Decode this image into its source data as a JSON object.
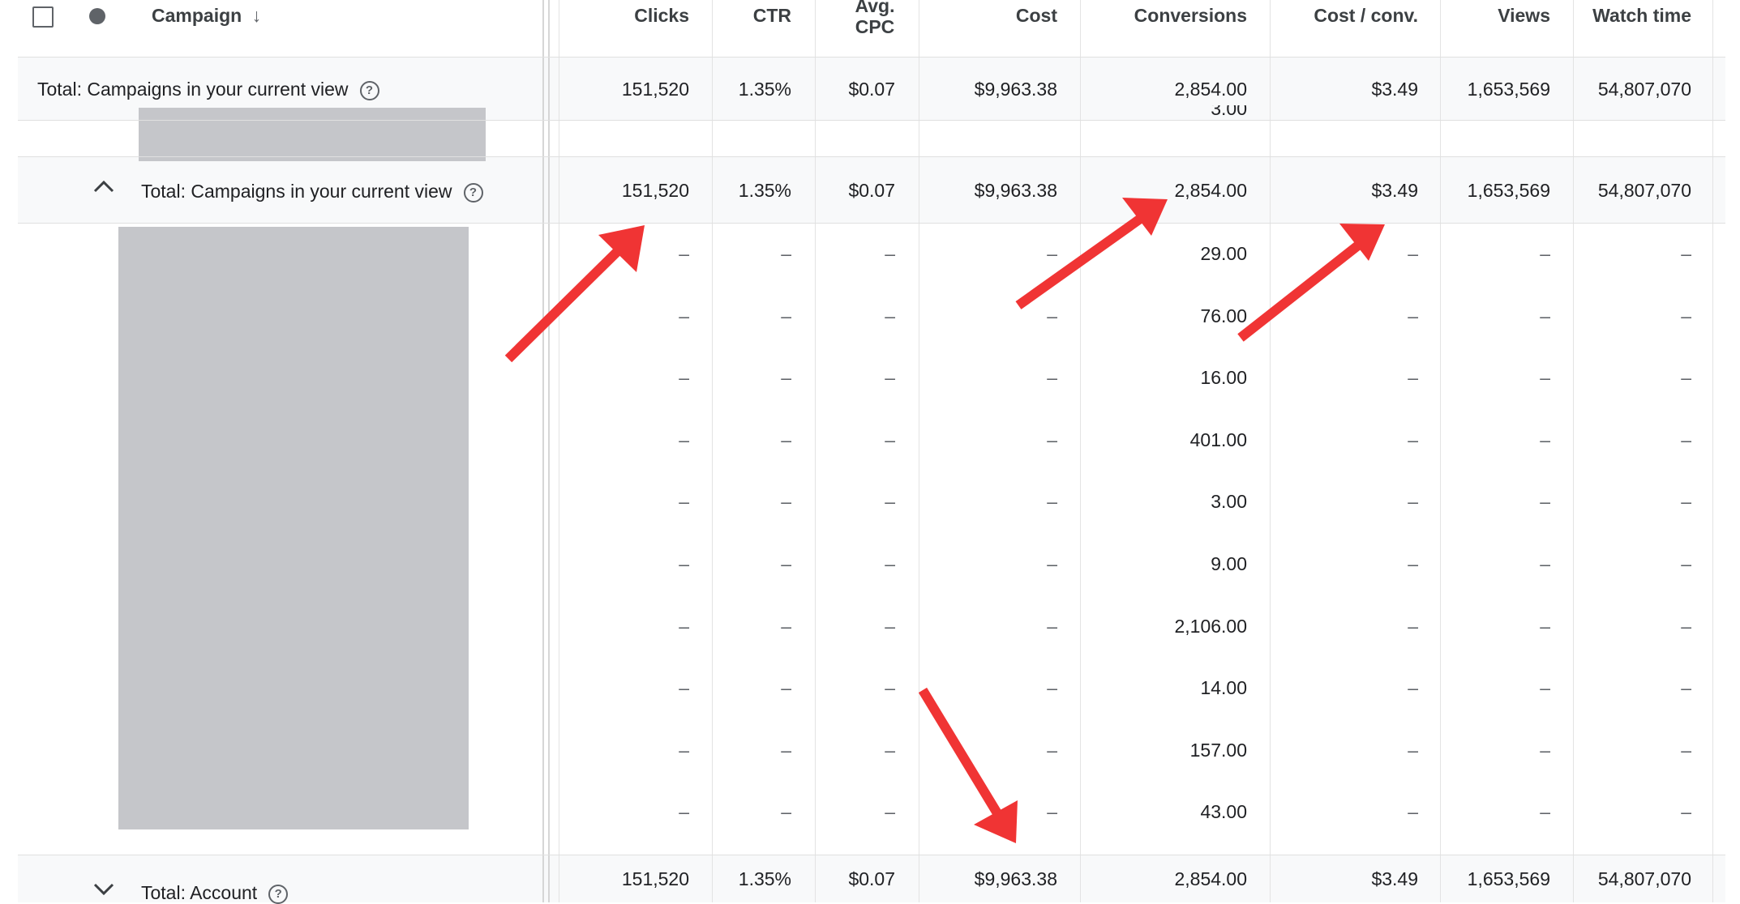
{
  "header": {
    "campaign_label": "Campaign",
    "columns": [
      {
        "key": "clicks",
        "label": "Clicks"
      },
      {
        "key": "ctr",
        "label": "CTR"
      },
      {
        "key": "avg_cpc",
        "label": "Avg.\nCPC"
      },
      {
        "key": "cost",
        "label": "Cost"
      },
      {
        "key": "conversions",
        "label": "Conversions"
      },
      {
        "key": "cost_conv",
        "label": "Cost / conv."
      },
      {
        "key": "views",
        "label": "Views"
      },
      {
        "key": "watch_time",
        "label": "Watch time"
      }
    ]
  },
  "total_view": {
    "label": "Total: Campaigns in your current view",
    "values": [
      "151,520",
      "1.35%",
      "$0.07",
      "$9,963.38",
      "2,854.00",
      "$3.49",
      "1,653,569",
      "54,807,070"
    ]
  },
  "partial_row_value": "3.00",
  "group_total": {
    "label": "Total: Campaigns in your current view",
    "values": [
      "151,520",
      "1.35%",
      "$0.07",
      "$9,963.38",
      "2,854.00",
      "$3.49",
      "1,653,569",
      "54,807,070"
    ]
  },
  "campaign_rows": [
    {
      "values": [
        "–",
        "–",
        "–",
        "–",
        "29.00",
        "–",
        "–",
        "–"
      ]
    },
    {
      "values": [
        "–",
        "–",
        "–",
        "–",
        "76.00",
        "–",
        "–",
        "–"
      ]
    },
    {
      "values": [
        "–",
        "–",
        "–",
        "–",
        "16.00",
        "–",
        "–",
        "–"
      ]
    },
    {
      "values": [
        "–",
        "–",
        "–",
        "–",
        "401.00",
        "–",
        "–",
        "–"
      ]
    },
    {
      "values": [
        "–",
        "–",
        "–",
        "–",
        "3.00",
        "–",
        "–",
        "–"
      ]
    },
    {
      "values": [
        "–",
        "–",
        "–",
        "–",
        "9.00",
        "–",
        "–",
        "–"
      ]
    },
    {
      "values": [
        "–",
        "–",
        "–",
        "–",
        "2,106.00",
        "–",
        "–",
        "–"
      ]
    },
    {
      "values": [
        "–",
        "–",
        "–",
        "–",
        "14.00",
        "–",
        "–",
        "–"
      ]
    },
    {
      "values": [
        "–",
        "–",
        "–",
        "–",
        "157.00",
        "–",
        "–",
        "–"
      ]
    },
    {
      "values": [
        "–",
        "–",
        "–",
        "–",
        "43.00",
        "–",
        "–",
        "–"
      ]
    }
  ],
  "account_total": {
    "label": "Total: Account",
    "values": [
      "151,520",
      "1.35%",
      "$0.07",
      "$9,963.38",
      "2,854.00",
      "$3.49",
      "1,653,569",
      "54,807,070"
    ]
  },
  "icons": {
    "checkbox": "checkbox-icon",
    "status": "status-dot-icon",
    "sort": "arrow-down-icon",
    "help": "help-circle-icon",
    "collapse": "chevron-up-icon",
    "expand": "chevron-down-icon"
  },
  "colors": {
    "annotation_arrow": "#f03434",
    "redaction": "#c5c6ca",
    "total_row_bg": "#f8f9fa"
  }
}
